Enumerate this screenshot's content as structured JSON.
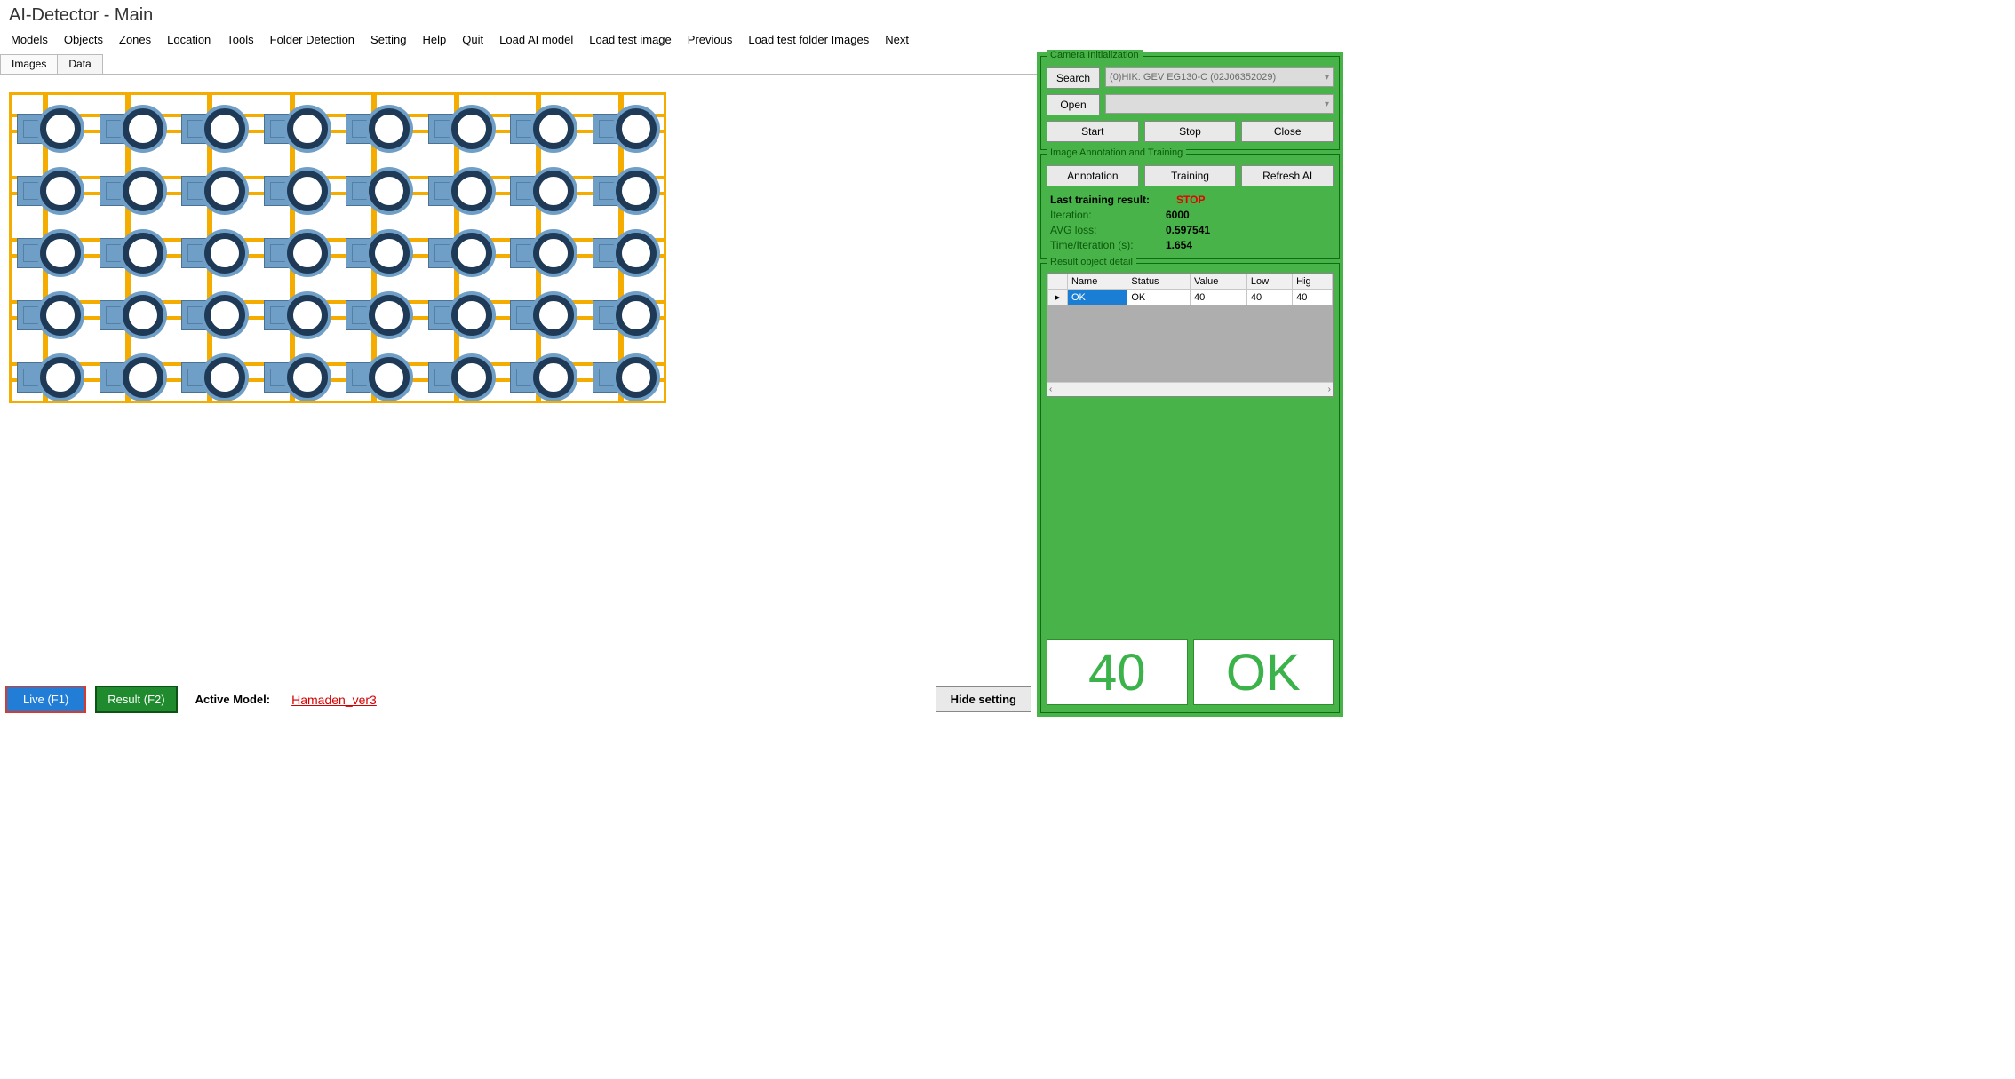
{
  "window": {
    "title": "AI-Detector - Main"
  },
  "menu": {
    "models": "Models",
    "objects": "Objects",
    "zones": "Zones",
    "location": "Location",
    "tools": "Tools",
    "folder_detection": "Folder Detection",
    "setting": "Setting",
    "help": "Help",
    "quit": "Quit",
    "load_ai": "Load AI model",
    "load_img": "Load test image",
    "previous": "Previous",
    "load_folder": "Load test folder Images",
    "next": "Next"
  },
  "tabs": {
    "images": "Images",
    "data": "Data"
  },
  "bottom": {
    "live": "Live (F1)",
    "result": "Result (F2)",
    "active_model_label": "Active Model:",
    "active_model_value": "Hamaden_ver3",
    "hide_setting": "Hide setting"
  },
  "camera": {
    "legend": "Camera Initialization",
    "search": "Search",
    "device": "(0)HIK: GEV EG130-C (02J06352029)",
    "open": "Open",
    "start": "Start",
    "stop": "Stop",
    "close": "Close"
  },
  "training": {
    "legend": "Image Annotation and Training",
    "annotation": "Annotation",
    "training_btn": "Training",
    "refresh": "Refresh AI",
    "last_label": "Last training result:",
    "stop": "STOP",
    "iter_label": "Iteration:",
    "iter_val": "6000",
    "avg_label": "AVG loss:",
    "avg_val": "0.597541",
    "time_label": "Time/Iteration (s):",
    "time_val": "1.654"
  },
  "result_detail": {
    "legend": "Result object detail",
    "headers": {
      "name": "Name",
      "status": "Status",
      "value": "Value",
      "low": "Low",
      "high": "Hig"
    },
    "row_marker": "▸",
    "rows": [
      {
        "name": "OK",
        "status": "OK",
        "value": "40",
        "low": "40",
        "high": "40"
      }
    ]
  },
  "big": {
    "count": "40",
    "status": "OK"
  },
  "chart_data": {
    "type": "image-grid",
    "rows": 5,
    "cols": 8,
    "cell_component": "sensor-ring",
    "detected_count": 40
  }
}
